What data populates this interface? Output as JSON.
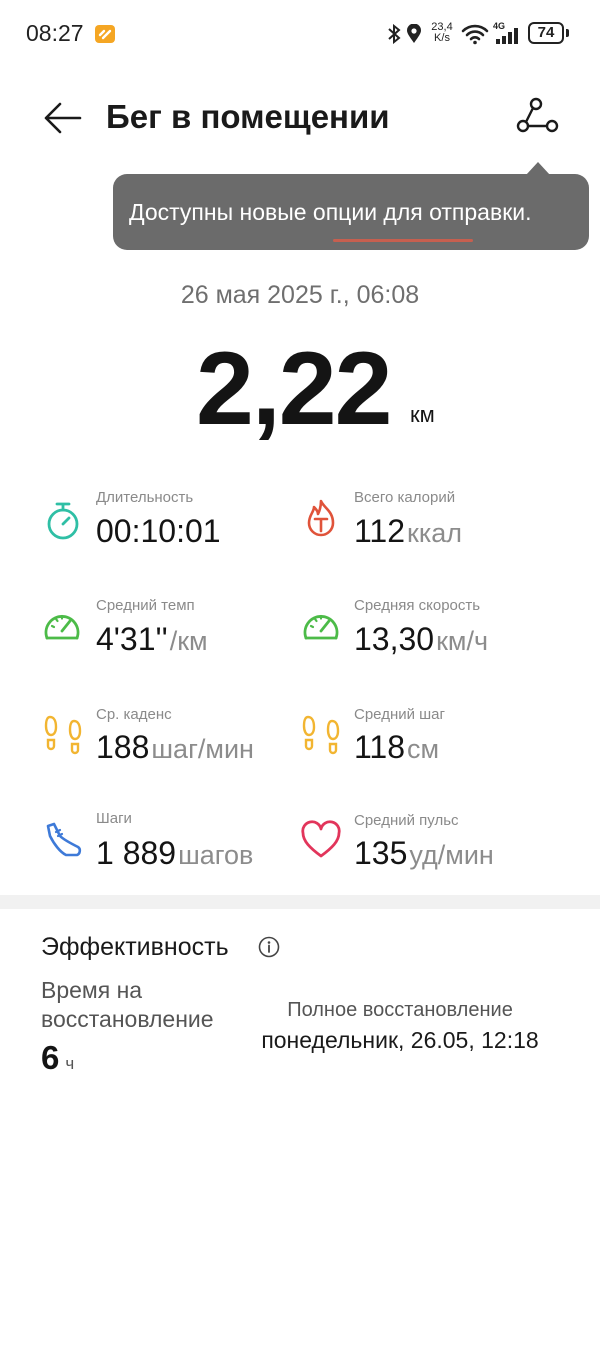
{
  "status_bar": {
    "time": "08:27",
    "net_speed_value": "23,4",
    "net_speed_unit": "K/s",
    "network": "4G",
    "battery": "74"
  },
  "header": {
    "title": "Бег в помещении"
  },
  "tooltip": {
    "text": "Доступны новые опции для отправки."
  },
  "workout": {
    "date": "26 мая 2025 г., 06:08",
    "distance": "2,22",
    "distance_unit": "км"
  },
  "stats": [
    {
      "label": "Длительность",
      "value": "00:10:01",
      "unit": "",
      "icon": "stopwatch-icon",
      "color": "#2fbfa5"
    },
    {
      "label": "Всего калорий",
      "value": "112",
      "unit": "ккал",
      "icon": "flame-icon",
      "color": "#e0533a"
    },
    {
      "label": "Средний темп",
      "value": "4'31''",
      "unit": "/км",
      "icon": "speedometer-icon",
      "color": "#4cbb48"
    },
    {
      "label": "Средняя скорость",
      "value": "13,30",
      "unit": "км/ч",
      "icon": "speedometer-icon",
      "color": "#4cbb48"
    },
    {
      "label": "Ср. каденс",
      "value": "188",
      "unit": "шаг/мин",
      "icon": "footprints-icon",
      "color": "#f2b531"
    },
    {
      "label": "Средний шаг",
      "value": "118",
      "unit": "см",
      "icon": "footprints-icon",
      "color": "#f2b531"
    },
    {
      "label": "Шаги",
      "value": "1 889",
      "unit": "шагов",
      "icon": "shoe-icon",
      "color": "#3e7ad8"
    },
    {
      "label": "Средний пульс",
      "value": "135",
      "unit": "уд/мин",
      "icon": "heart-icon",
      "color": "#e2355b"
    }
  ],
  "efficiency": {
    "title": "Эффективность",
    "recovery_label": "Время на восстановление",
    "recovery_value": "6",
    "recovery_unit": "ч",
    "full_recovery_label": "Полное восстановление",
    "full_recovery_value": "понедельник, 26.05, 12:18"
  }
}
